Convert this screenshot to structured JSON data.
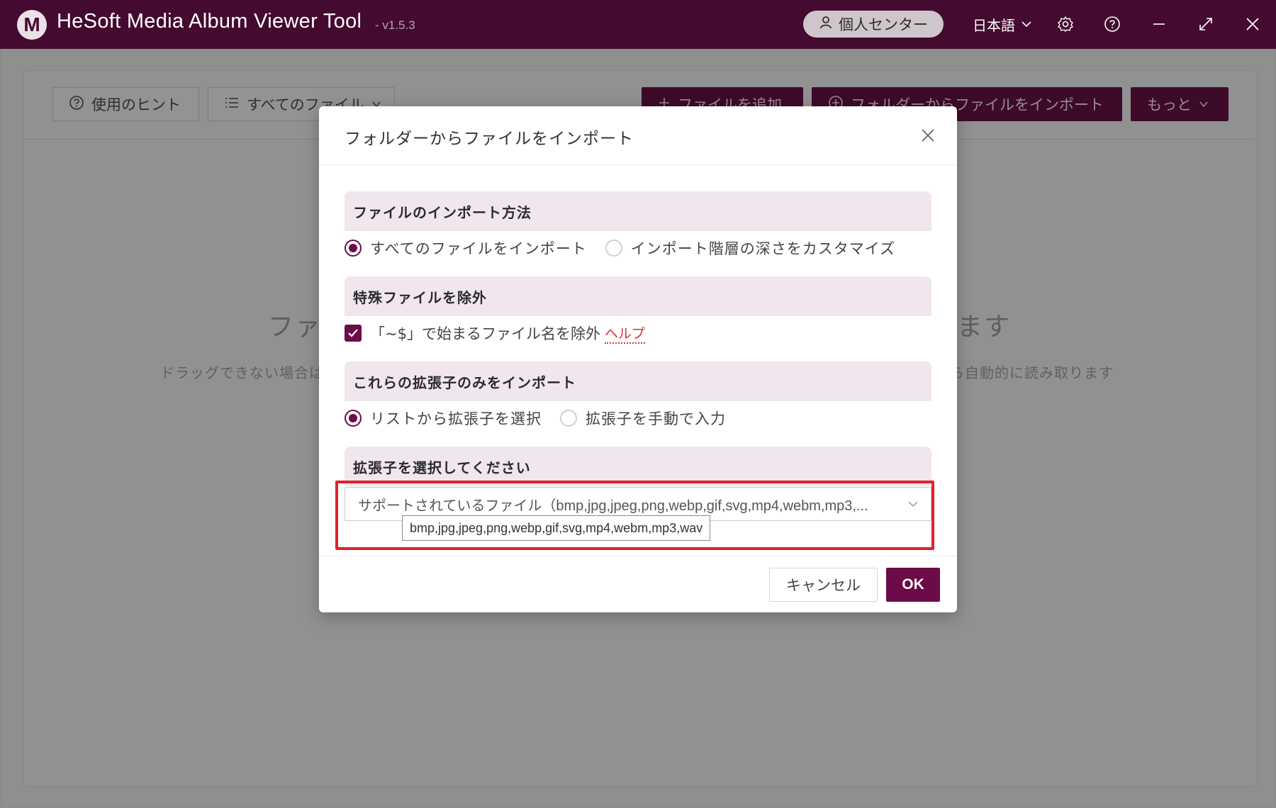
{
  "app": {
    "logo_letter": "M",
    "title": "HeSoft Media Album Viewer Tool",
    "version": "- v1.5.3",
    "user_center": "個人センター",
    "language": "日本語"
  },
  "toolbar": {
    "hints": "使用のヒント",
    "all_files": "すべてのファイル",
    "add_file": "ファイルを追加",
    "import_folder": "フォルダーからファイルをインポート",
    "more": "もっと"
  },
  "background": {
    "big_left": "ファ",
    "big_right": "ます",
    "small_left": "ドラッグできない場合は",
    "small_right": "ら自動的に読み取ります"
  },
  "dialog": {
    "title": "フォルダーからファイルをインポート",
    "import_method": {
      "heading": "ファイルのインポート方法",
      "options": [
        {
          "label": "すべてのファイルをインポート",
          "checked": true
        },
        {
          "label": "インポート階層の深さをカスタマイズ",
          "checked": false
        }
      ]
    },
    "exclude": {
      "heading": "特殊ファイルを除外",
      "checkbox_label": "「~$」で始まるファイル名を除外",
      "checked": true,
      "help": "ヘルプ"
    },
    "extensions": {
      "heading": "これらの拡張子のみをインポート",
      "options": [
        {
          "label": "リストから拡張子を選択",
          "checked": true
        },
        {
          "label": "拡張子を手動で入力",
          "checked": false
        }
      ]
    },
    "select_extensions": {
      "heading": "拡張子を選択してください",
      "value": "サポートされているファイル（bmp,jpg,jpeg,png,webp,gif,svg,mp4,webm,mp3,...",
      "tooltip": "bmp,jpg,jpeg,png,webp,gif,svg,mp4,webm,mp3,wav"
    },
    "cancel": "キャンセル",
    "ok": "OK"
  },
  "colors": {
    "brand": "#450a30",
    "accent": "#6b0b47",
    "highlight": "#e0222c",
    "link": "#d4343a"
  }
}
